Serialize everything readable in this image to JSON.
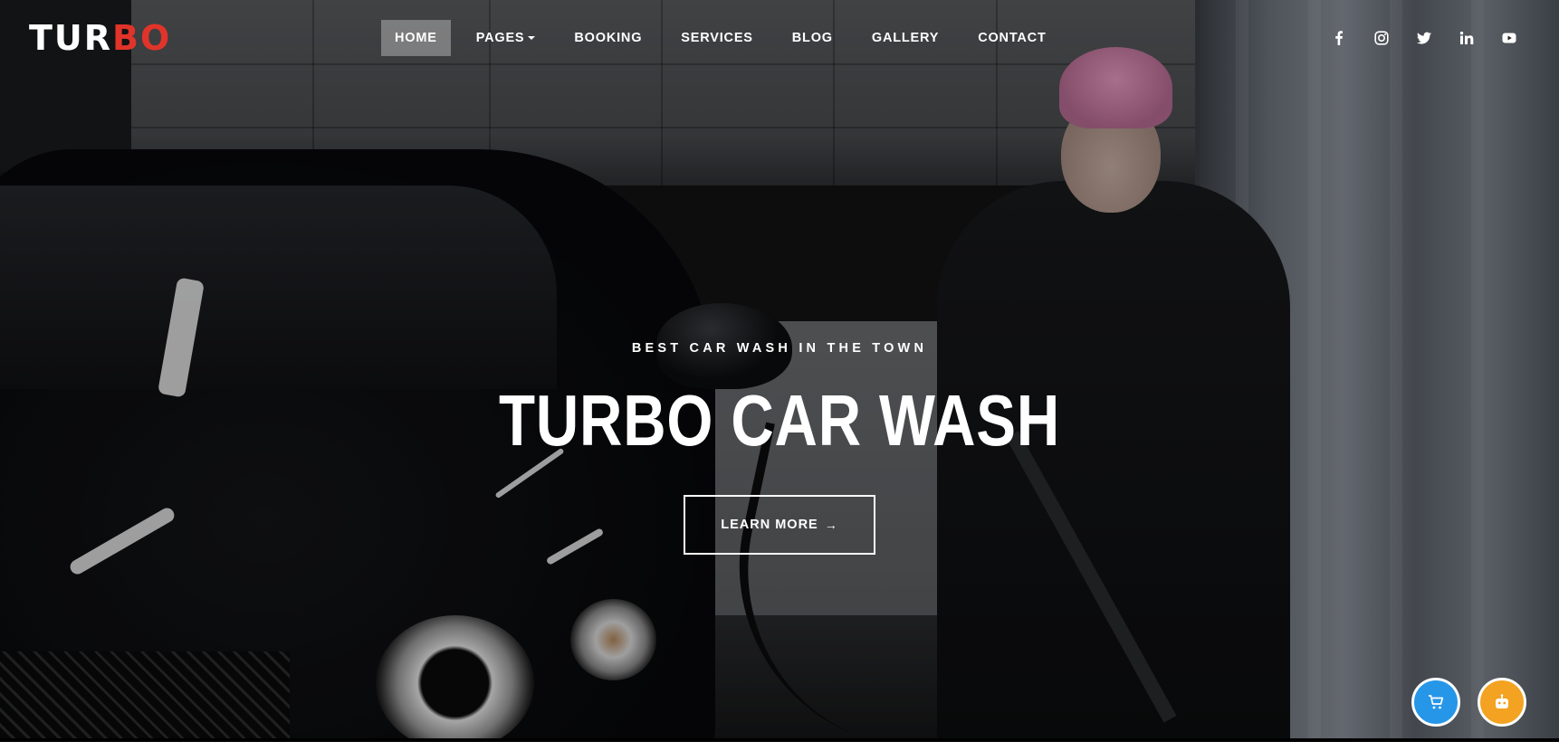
{
  "logo": {
    "part1": "TUR",
    "part2": "BO",
    "accent_color": "#e0342a"
  },
  "nav": {
    "items": [
      {
        "label": "HOME",
        "active": true
      },
      {
        "label": "PAGES",
        "dropdown": true
      },
      {
        "label": "BOOKING"
      },
      {
        "label": "SERVICES"
      },
      {
        "label": "BLOG"
      },
      {
        "label": "GALLERY"
      },
      {
        "label": "CONTACT"
      }
    ]
  },
  "social": {
    "icons": [
      "facebook-icon",
      "instagram-icon",
      "twitter-icon",
      "linkedin-icon",
      "youtube-icon"
    ]
  },
  "hero": {
    "tagline": "BEST CAR WASH IN THE TOWN",
    "title": "TURBO CAR WASH",
    "cta_label": "LEARN MORE",
    "cta_arrow": "→"
  },
  "floating": {
    "cart": {
      "icon": "cart-icon",
      "color": "#2696e8"
    },
    "bot": {
      "icon": "robot-icon",
      "color": "#f3a321"
    }
  }
}
